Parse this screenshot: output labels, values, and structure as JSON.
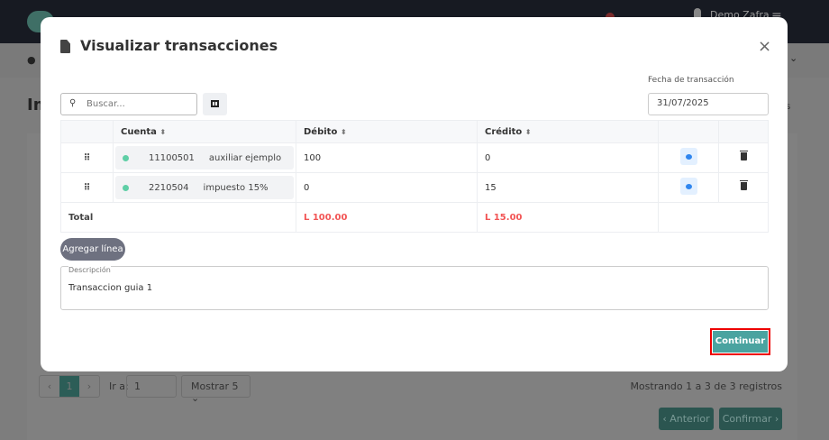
{
  "background": {
    "user_name": "Demo Zafra",
    "page_title_partial": "Im",
    "right_label_partial": "es",
    "pagination": {
      "prev": "‹",
      "current": "1",
      "next": "›",
      "goto_label": "Ir a:",
      "goto_value": "1",
      "page_size": "Mostrar 5 ⌄",
      "summary": "Mostrando 1 a 3 de 3 registros"
    },
    "buttons": {
      "previous": "‹ Anterior",
      "confirm": "Confirmar ›"
    }
  },
  "modal": {
    "title": "Visualizar transacciones",
    "close": "×",
    "search_placeholder": "Buscar...",
    "date_label": "Fecha de transacción",
    "date_value": "31/07/2025",
    "columns": {
      "account": "Cuenta",
      "debit": "Débito",
      "credit": "Crédito",
      "sort": "⬍"
    },
    "rows": [
      {
        "code": "11100501",
        "name": "auxiliar ejemplo",
        "debit": "100",
        "credit": "0"
      },
      {
        "code": "2210504",
        "name": "impuesto 15%",
        "debit": "0",
        "credit": "15"
      }
    ],
    "total": {
      "label": "Total",
      "debit": "L 100.00",
      "credit": "L 15.00"
    },
    "add_line": "Agregar línea",
    "description_label": "Descripción",
    "description_value": "Transaccion guia 1",
    "continue": "Continuar",
    "colors": {
      "accent": "#4aa3a0",
      "total": "#f25555",
      "status_dot": "#5fcfa6",
      "highlight_border": "#ee0000"
    }
  }
}
